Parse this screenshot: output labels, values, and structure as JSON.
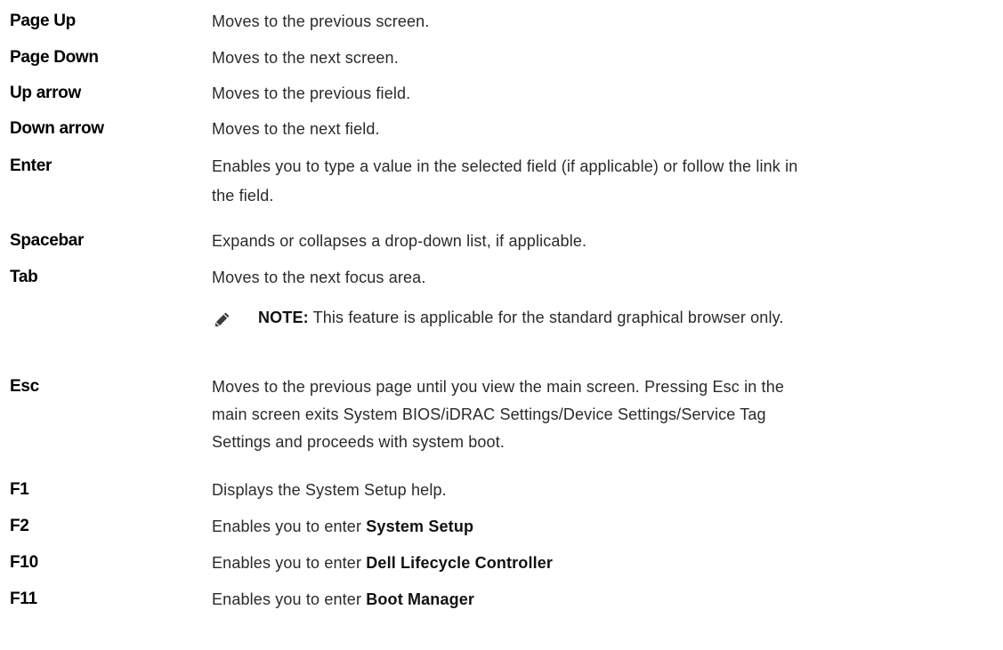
{
  "rows": [
    {
      "key": "Page Up",
      "desc": "Moves to the previous screen."
    },
    {
      "key": "Page Down",
      "desc": "Moves to the next screen."
    },
    {
      "key": "Up arrow",
      "desc": "Moves to the previous field."
    },
    {
      "key": "Down arrow",
      "desc": "Moves to the next field."
    },
    {
      "key": "Enter",
      "desc_line1": "Enables you to type a value in the selected field (if applicable) or follow the link in",
      "desc_line2": "the field."
    },
    {
      "key": "Spacebar",
      "desc": "Expands or collapses a drop-down list, if applicable."
    },
    {
      "key": "Tab",
      "desc": "Moves to the next focus area."
    },
    {
      "key": "Esc",
      "desc_line1": "Moves to the previous page until you view the main screen. Pressing Esc in the",
      "desc_line2": "main screen exits System BIOS/iDRAC Settings/Device Settings/Service Tag",
      "desc_line3": "Settings and proceeds with system boot."
    },
    {
      "key": "F1",
      "desc": "Displays the System Setup help."
    },
    {
      "key": "F2",
      "desc_prefix": "Enables you to enter ",
      "desc_bold": "System Setup"
    },
    {
      "key": "F10",
      "desc_prefix": "Enables you to enter ",
      "desc_bold": "Dell Lifecycle Controller"
    },
    {
      "key": "F11",
      "desc_prefix": "Enables you to enter ",
      "desc_bold": "Boot Manager"
    }
  ],
  "note": {
    "icon": "pencil-note-icon",
    "label": "NOTE:",
    "text": " This feature is applicable for the standard graphical browser only."
  },
  "colors": {
    "text": "#2a2a2a",
    "key": "#000000"
  }
}
